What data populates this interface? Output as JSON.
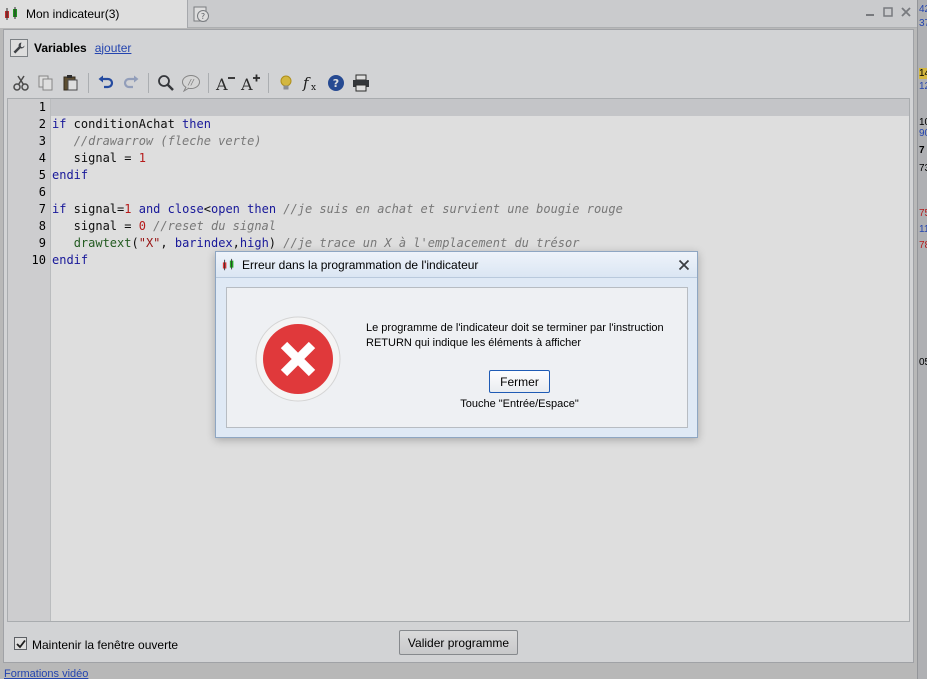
{
  "tab": {
    "title": "Mon indicateur(3)"
  },
  "variables": {
    "title": "Variables",
    "add_link": "ajouter"
  },
  "editor": {
    "line_numbers": [
      "1",
      "2",
      "3",
      "4",
      "5",
      "6",
      "7",
      "8",
      "9",
      "10"
    ]
  },
  "footer": {
    "keep_open_label": "Maintenir la fenêtre ouverte",
    "keep_open_checked": true,
    "validate_label": "Valider programme"
  },
  "bottom_link": "Formations vidéo",
  "right_strip_values": [
    "42",
    "37",
    "14",
    "12",
    "10",
    "90",
    "7",
    "73",
    "75",
    "11",
    "78",
    "05"
  ],
  "dialog": {
    "title": "Erreur dans la programmation de l'indicateur",
    "message": "Le programme de l'indicateur doit se terminer par l'instruction RETURN qui indique les éléments à afficher",
    "button_label": "Fermer",
    "hint": "Touche \"Entrée/Espace\""
  },
  "colors": {
    "keyword": "#1c1cb0",
    "number": "#d12020",
    "comment": "#8a8a8a",
    "function": "#2a6a28",
    "error_red": "#e0393b",
    "link": "#2a4fc9"
  },
  "icons": [
    "app-indicator-icon",
    "help-icon",
    "wrench-icon",
    "cut-icon",
    "copy-icon",
    "paste-icon",
    "undo-icon",
    "redo-icon",
    "search-icon",
    "comment-icon",
    "font-decrease-icon",
    "font-increase-icon",
    "bulb-icon",
    "function-icon",
    "info-icon",
    "print-icon",
    "close-icon",
    "error-icon"
  ]
}
